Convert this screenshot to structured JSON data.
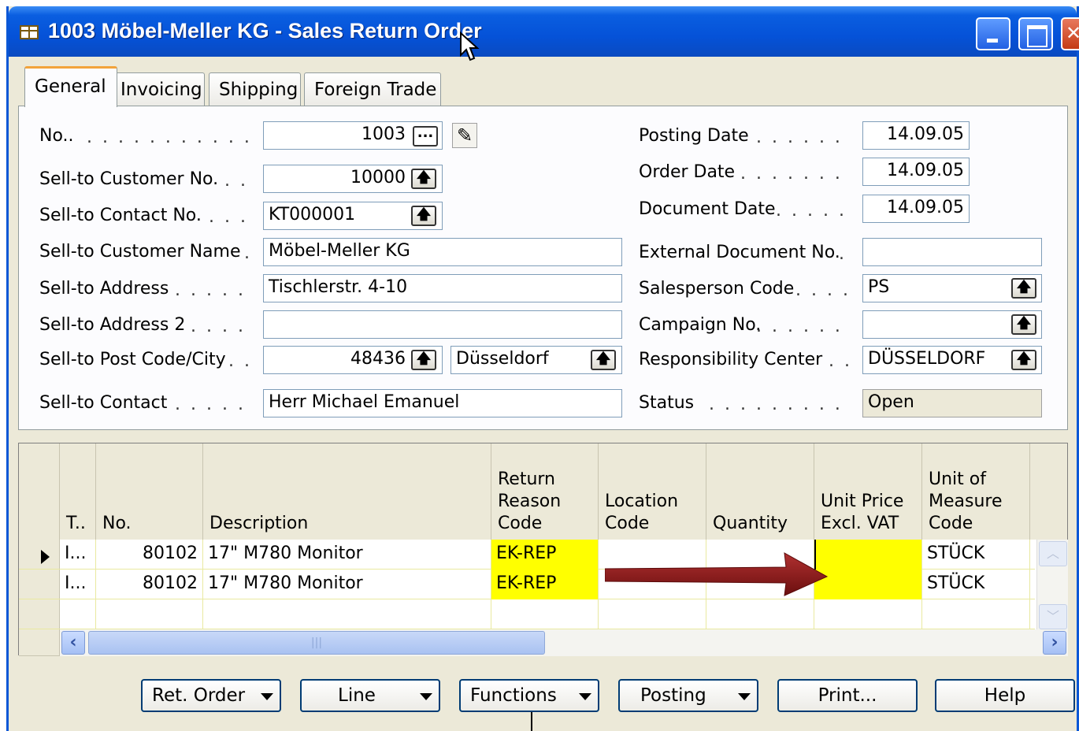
{
  "window": {
    "title": "1003 Möbel-Meller KG - Sales Return Order"
  },
  "tabs": [
    "General",
    "Invoicing",
    "Shipping",
    "Foreign Trade"
  ],
  "general": {
    "left": [
      {
        "label": "No..",
        "value": "1003"
      },
      {
        "label": "Sell-to Customer No.",
        "value": "10000"
      },
      {
        "label": "Sell-to Contact No.",
        "value": "KT000001"
      },
      {
        "label": "Sell-to Customer Name",
        "value": "Möbel-Meller KG"
      },
      {
        "label": "Sell-to Address",
        "value": "Tischlerstr. 4-10"
      },
      {
        "label": "Sell-to Address 2",
        "value": ""
      },
      {
        "label": "Sell-to Post Code/City",
        "value": "48436",
        "city": "Düsseldorf"
      },
      {
        "label": "Sell-to Contact",
        "value": "Herr Michael Emanuel"
      }
    ],
    "right": [
      {
        "label": "Posting Date",
        "value": "14.09.05"
      },
      {
        "label": "Order Date",
        "value": "14.09.05"
      },
      {
        "label": "Document Date",
        "value": "14.09.05"
      },
      {
        "label": "External Document No.",
        "value": ""
      },
      {
        "label": "Salesperson Code",
        "value": "PS"
      },
      {
        "label": "Campaign No.",
        "value": ""
      },
      {
        "label": "Responsibility Center",
        "value": "DÜSSELDORF"
      },
      {
        "label": "Status",
        "value": "Open"
      }
    ]
  },
  "lines": {
    "columns": [
      "T..",
      "No.",
      "Description",
      "Return Reason Code",
      "Location Code",
      "Quantity",
      "Unit Price Excl. VAT",
      "Unit of Measure Code"
    ],
    "rows": [
      {
        "type": "I...",
        "no": "80102",
        "description": "17\" M780 Monitor",
        "return_reason": "EK-REP",
        "location": "",
        "quantity": "",
        "unit_price": "",
        "uom": "STÜCK"
      },
      {
        "type": "I...",
        "no": "80102",
        "description": "17\" M780 Monitor",
        "return_reason": "EK-REP",
        "location": "",
        "quantity": "",
        "unit_price": "",
        "uom": "STÜCK"
      }
    ]
  },
  "buttons": {
    "ret_order": "Ret. Order",
    "line": "Line",
    "functions": "Functions",
    "posting": "Posting",
    "print": "Print...",
    "help": "Help"
  },
  "colors": {
    "highlight": "#ffff00",
    "arrow": "#8b1a1a",
    "title_bar": "#0552d8"
  }
}
